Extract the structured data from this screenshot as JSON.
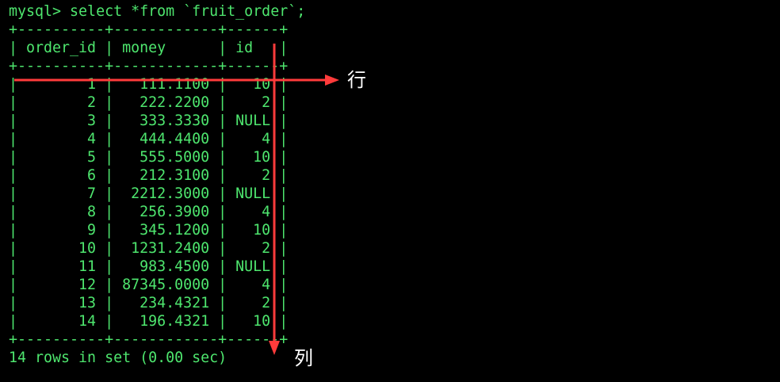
{
  "terminal": {
    "prompt": "mysql> ",
    "command": "select *from `fruit_order`;",
    "border": "+----------+------------+------+",
    "columns": [
      "order_id",
      "money",
      "id"
    ],
    "rows": [
      [
        "1",
        "111.1100",
        "10"
      ],
      [
        "2",
        "222.2200",
        "2"
      ],
      [
        "3",
        "333.3330",
        "NULL"
      ],
      [
        "4",
        "444.4400",
        "4"
      ],
      [
        "5",
        "555.5000",
        "10"
      ],
      [
        "6",
        "212.3100",
        "2"
      ],
      [
        "7",
        "2212.3000",
        "NULL"
      ],
      [
        "8",
        "256.3900",
        "4"
      ],
      [
        "9",
        "345.1200",
        "10"
      ],
      [
        "10",
        "1231.2400",
        "2"
      ],
      [
        "11",
        "983.4500",
        "NULL"
      ],
      [
        "12",
        "87345.0000",
        "4"
      ],
      [
        "13",
        "234.4321",
        "2"
      ],
      [
        "14",
        "196.4321",
        "10"
      ]
    ],
    "footer": "14 rows in set (0.00 sec)"
  },
  "annotations": {
    "row_label": "行",
    "column_label": "列",
    "arrow_color": "#ff3b3b"
  },
  "colors": {
    "background": "#000000",
    "text": "#4ee66e"
  }
}
